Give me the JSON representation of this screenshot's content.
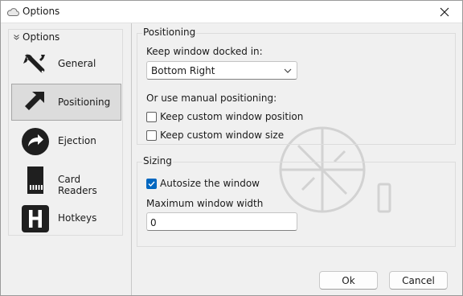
{
  "window": {
    "title": "Options",
    "close_glyph": "✕"
  },
  "sidebar": {
    "header": "Options",
    "items": [
      {
        "label": "General",
        "icon": "wrench-icon",
        "selected": false
      },
      {
        "label": "Positioning",
        "icon": "arrow-up-left-icon",
        "selected": true
      },
      {
        "label": "Ejection",
        "icon": "eject-arrow-icon",
        "selected": false
      },
      {
        "label": "Card Readers",
        "icon": "sd-card-icon",
        "selected": false
      },
      {
        "label": "Hotkeys",
        "icon": "hotkey-h-icon",
        "selected": false
      }
    ]
  },
  "positioning": {
    "group_title": "Positioning",
    "docked_label": "Keep window docked in:",
    "docked_value": "Bottom Right",
    "manual_label": "Or use manual positioning:",
    "keep_position_label": "Keep custom window position",
    "keep_position_checked": false,
    "keep_size_label": "Keep custom window size",
    "keep_size_checked": false
  },
  "sizing": {
    "group_title": "Sizing",
    "autosize_label": "Autosize the window",
    "autosize_checked": true,
    "max_width_label": "Maximum window width",
    "max_width_value": "0"
  },
  "buttons": {
    "ok": "Ok",
    "cancel": "Cancel"
  },
  "colors": {
    "accent": "#0067c0",
    "selected_bg": "#dcdcdc"
  }
}
